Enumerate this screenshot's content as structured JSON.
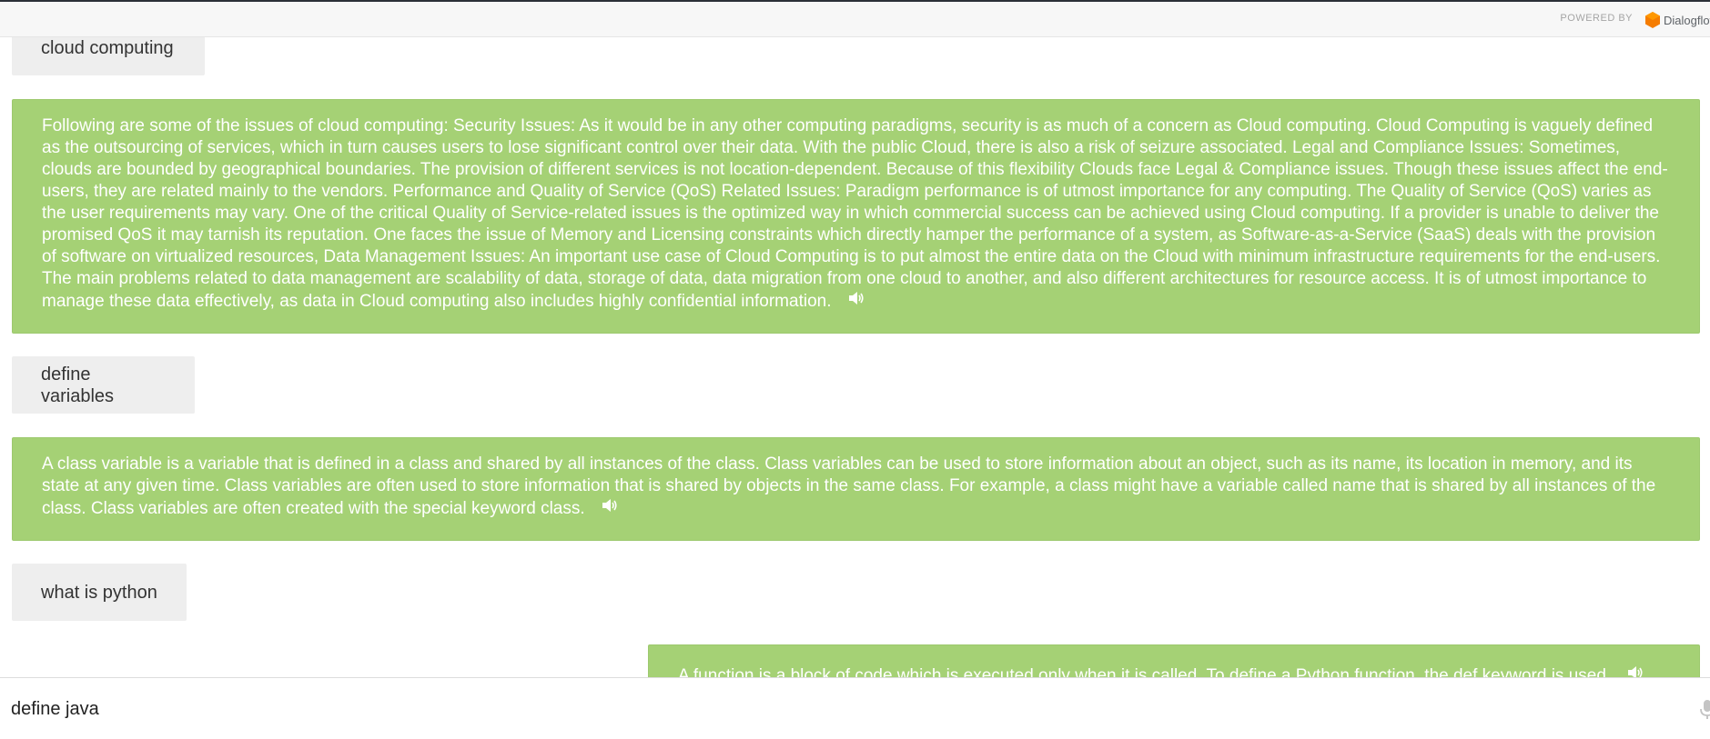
{
  "header": {
    "powered_by": "POWERED BY",
    "brand": "Dialogflow",
    "brand_color": "#f57c00"
  },
  "messages": [
    {
      "role": "user",
      "text": "cloud computing"
    },
    {
      "role": "bot",
      "text": "Following are some of the issues of cloud computing: Security Issues: As it would be in any other computing paradigms, security is as much of a concern as Cloud computing. Cloud Computing is vaguely defined as the outsourcing of services, which in turn causes users to lose significant control over their data. With the public Cloud, there is also a risk of seizure associated. Legal and Compliance Issues: Sometimes, clouds are bounded by geographical boundaries. The provision of different services is not location-dependent. Because of this flexibility Clouds face Legal & Compliance issues. Though these issues affect the end-users, they are related mainly to the vendors. Performance and Quality of Service (QoS) Related Issues: Paradigm performance is of utmost importance for any computing. The Quality of Service (QoS) varies as the user requirements may vary. One of the critical Quality of Service-related issues is the optimized way in which commercial success can be achieved using Cloud computing. If a provider is unable to deliver the promised QoS it may tarnish its reputation. One faces the issue of Memory and Licensing constraints which directly hamper the performance of a system, as Software-as-a-Service (SaaS) deals with the provision of software on virtualized resources, Data Management Issues: An important use case of Cloud Computing is to put almost the entire data on the Cloud with minimum infrastructure requirements for the end-users. The main problems related to data management are scalability of data, storage of data, data migration from one cloud to another, and also different architectures for resource access. It is of utmost importance to manage these data effectively, as data in Cloud computing also includes highly confidential information.",
      "icon": "speaker-icon"
    },
    {
      "role": "user",
      "text": "define variables"
    },
    {
      "role": "bot",
      "text": "A class variable is a variable that is defined in a class and shared by all instances of the class. Class variables can be used to store information about an object, such as its name, its location in memory, and its state at any given time. Class variables are often used to store information that is shared by objects in the same class. For example, a class might have a variable called name that is shared by all instances of the class. Class variables are often created with the special keyword class.",
      "icon": "speaker-icon"
    },
    {
      "role": "user",
      "text": "what is python"
    },
    {
      "role": "bot",
      "text": "A function is a block of code which is executed only when it is called. To define a Python function, the def keyword is used.",
      "icon": "speaker-icon"
    }
  ],
  "input": {
    "value": "define java",
    "icon": "microphone-icon"
  },
  "colors": {
    "bot_bubble": "#a5d175",
    "user_bubble": "#eeeeee"
  }
}
